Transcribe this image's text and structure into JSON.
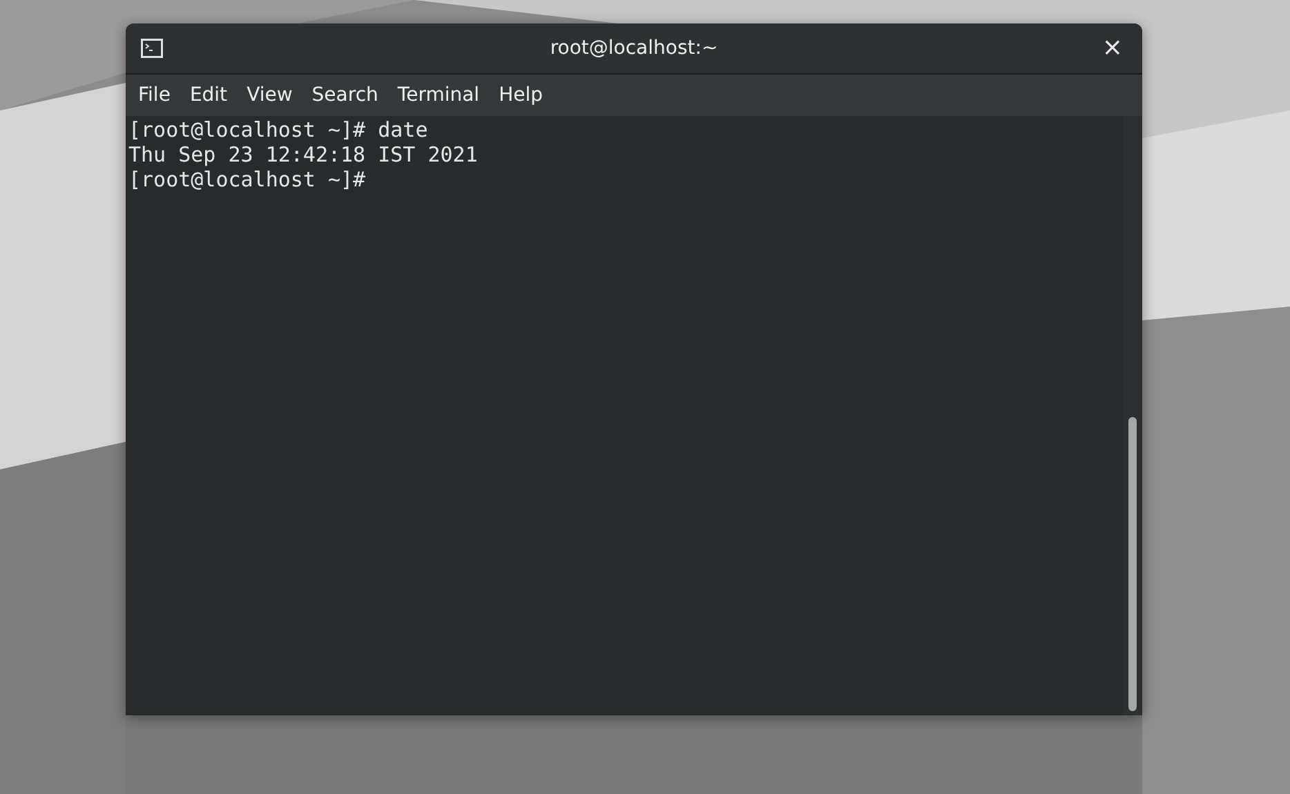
{
  "window": {
    "title": "root@localhost:~",
    "close": "×"
  },
  "menu": [
    {
      "label": "File"
    },
    {
      "label": "Edit"
    },
    {
      "label": "View"
    },
    {
      "label": "Search"
    },
    {
      "label": "Terminal"
    },
    {
      "label": "Help"
    }
  ],
  "terminal": {
    "lines": [
      {
        "kind": "prompt",
        "prompt": "[root@localhost ~]#",
        "command": "date"
      },
      {
        "kind": "output",
        "text": "Thu Sep 23 12:42:18 IST 2021"
      },
      {
        "kind": "prompt",
        "prompt": "[root@localhost ~]#"
      }
    ]
  }
}
